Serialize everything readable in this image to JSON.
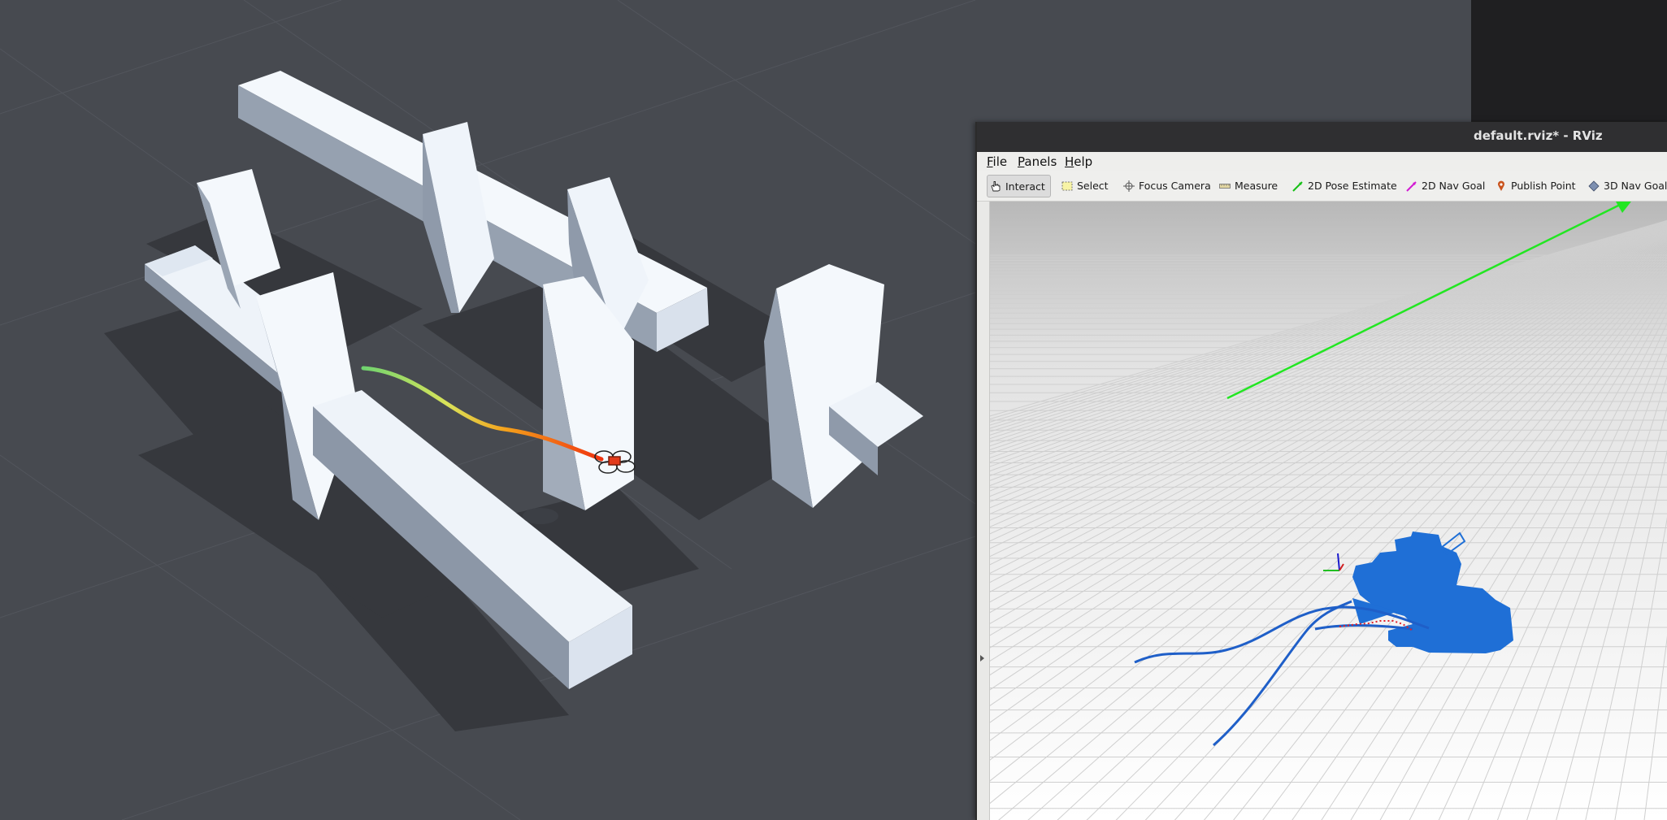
{
  "rviz": {
    "title": "default.rviz* - RViz",
    "menus": [
      "File",
      "Panels",
      "Help"
    ],
    "tools": [
      {
        "label": "Interact",
        "icon": "hand-pointer-icon",
        "active": true
      },
      {
        "label": "Select",
        "icon": "select-box-icon",
        "active": false
      },
      {
        "label": "Focus Camera",
        "icon": "focus-crosshair-icon",
        "active": false
      },
      {
        "label": "Measure",
        "icon": "ruler-icon",
        "active": false
      },
      {
        "label": "2D Pose Estimate",
        "icon": "green-arrow-icon",
        "active": false
      },
      {
        "label": "2D Nav Goal",
        "icon": "magenta-arrow-icon",
        "active": false
      },
      {
        "label": "Publish Point",
        "icon": "map-pin-icon",
        "active": false
      },
      {
        "label": "3D Nav Goal",
        "icon": "diamond-icon",
        "active": false
      }
    ]
  },
  "colors": {
    "sim_background": "#474a50",
    "obstacle_face": "#f4f8fc",
    "trajectory_start": "#7ee07e",
    "trajectory_end": "#f0430f",
    "rviz_map": "#1f6fd6",
    "goal_arrow": "#1fe61f",
    "grid_line": "#d2d2d2"
  }
}
